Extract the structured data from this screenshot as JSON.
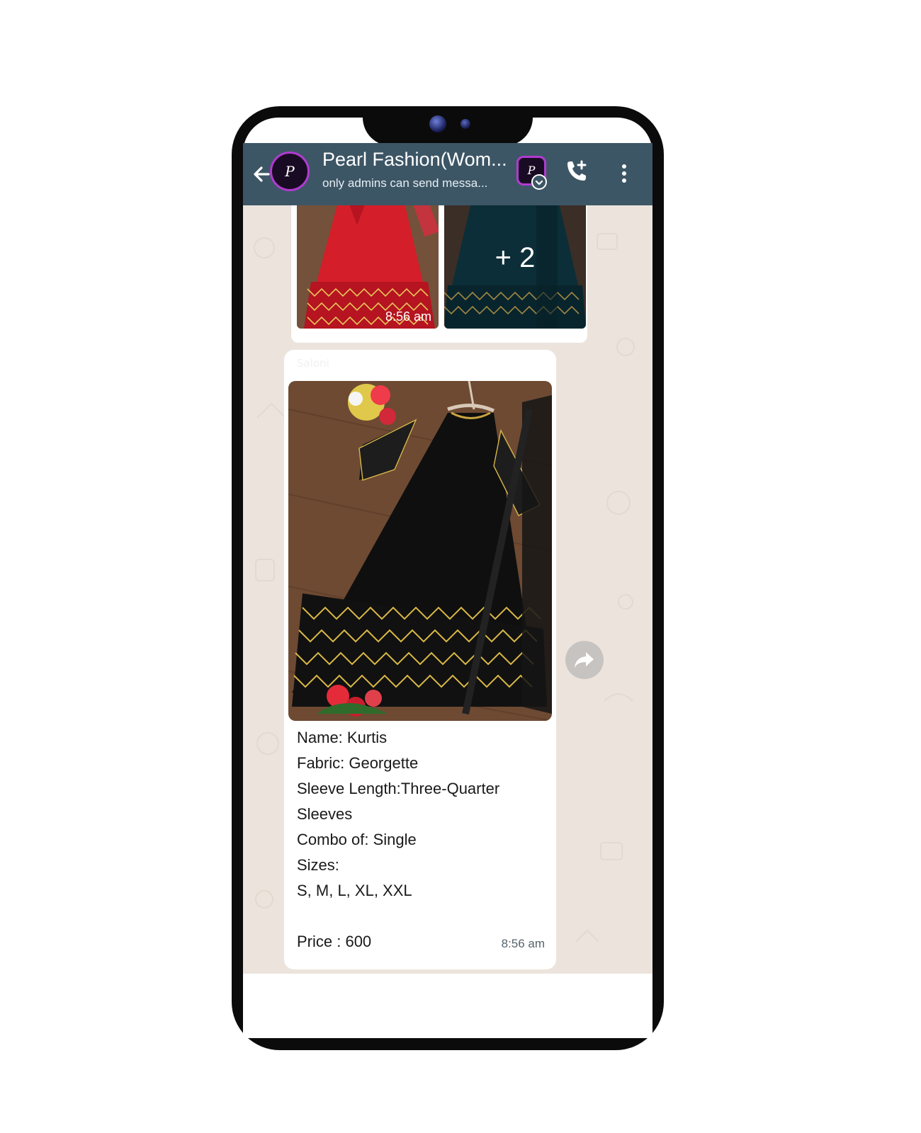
{
  "header": {
    "avatar_letter": "P",
    "title": "Pearl Fashion(Wom...",
    "subtitle": "only admins can send messa...",
    "icons": {
      "back": "back-arrow-icon",
      "call": "add-call-icon",
      "menu": "more-vert-icon",
      "badge": "chevron-down-icon"
    },
    "colors": {
      "header_bg": "#3d5666",
      "avatar_ring": "#b13bd0"
    }
  },
  "gallery": {
    "time": "8:56 am",
    "more_count": "+ 2"
  },
  "message": {
    "sender": "Saloni",
    "lines": [
      "Name: Kurtis",
      "Fabric: Georgette",
      "Sleeve Length:Three-Quarter",
      "Sleeves",
      "Combo of: Single",
      "Sizes:",
      "S, M, L, XL, XXL",
      "",
      "Price : 600"
    ],
    "time": "8:56 am"
  },
  "actions": {
    "forward_icon": "forward-icon"
  },
  "colors": {
    "chat_bg": "#ece4dc",
    "bubble_bg": "#ffffff"
  }
}
